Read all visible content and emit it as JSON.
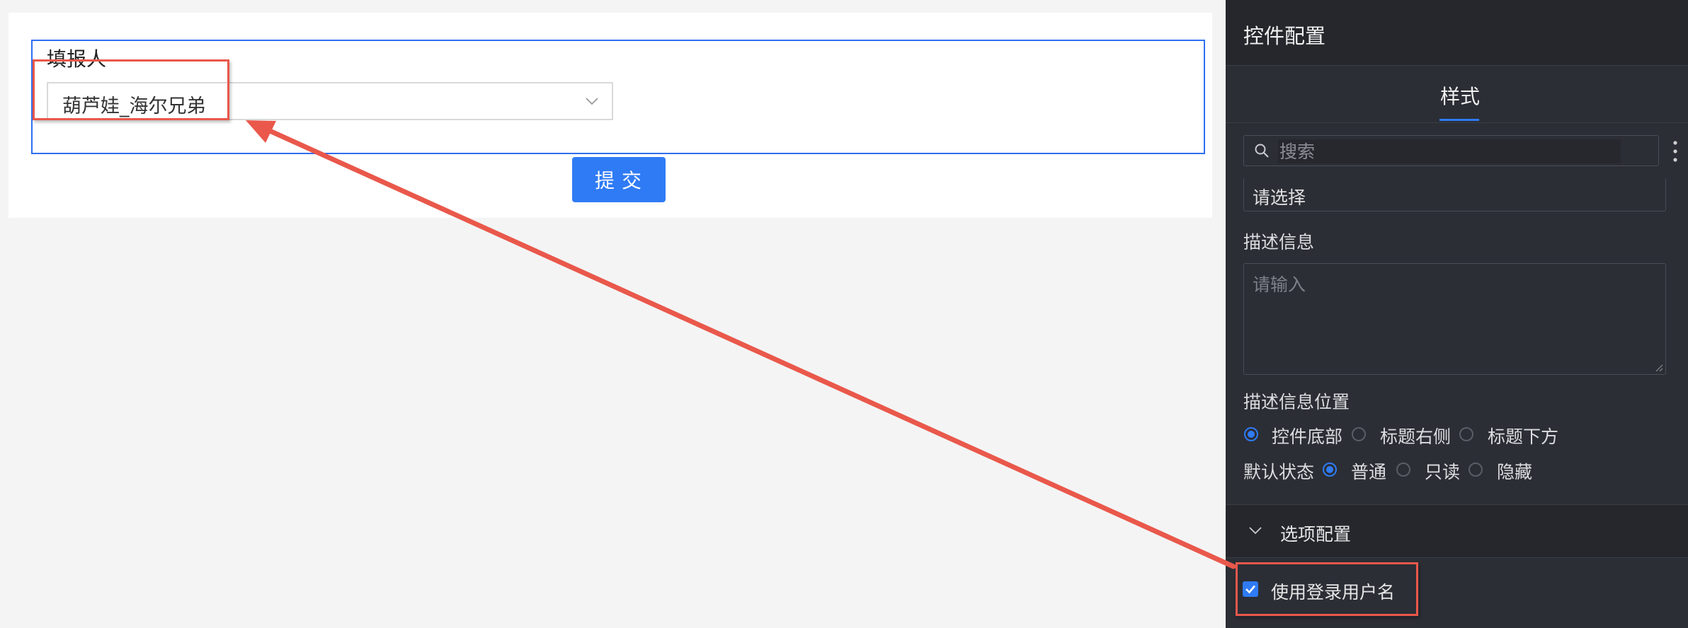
{
  "form": {
    "field_title": "填报人",
    "select_value": "葫芦娃_海尔兄弟",
    "submit_label": "提交"
  },
  "panel": {
    "title": "控件配置",
    "tab_style": "样式",
    "search_placeholder": "搜索",
    "placeholder_value": "请选择",
    "desc_label": "描述信息",
    "desc_placeholder": "请输入",
    "desc_position_label": "描述信息位置",
    "desc_position_options": [
      "控件底部",
      "标题右侧",
      "标题下方"
    ],
    "desc_position_selected": "控件底部",
    "default_state_label": "默认状态",
    "default_state_options": [
      "普通",
      "只读",
      "隐藏"
    ],
    "default_state_selected": "普通",
    "section_title": "选项配置",
    "use_login_username_label": "使用登录用户名",
    "use_login_username_checked": true
  },
  "colors": {
    "accent": "#2f7bf5",
    "annotation": "#e9584b",
    "panel_bg": "#2b2e35"
  }
}
